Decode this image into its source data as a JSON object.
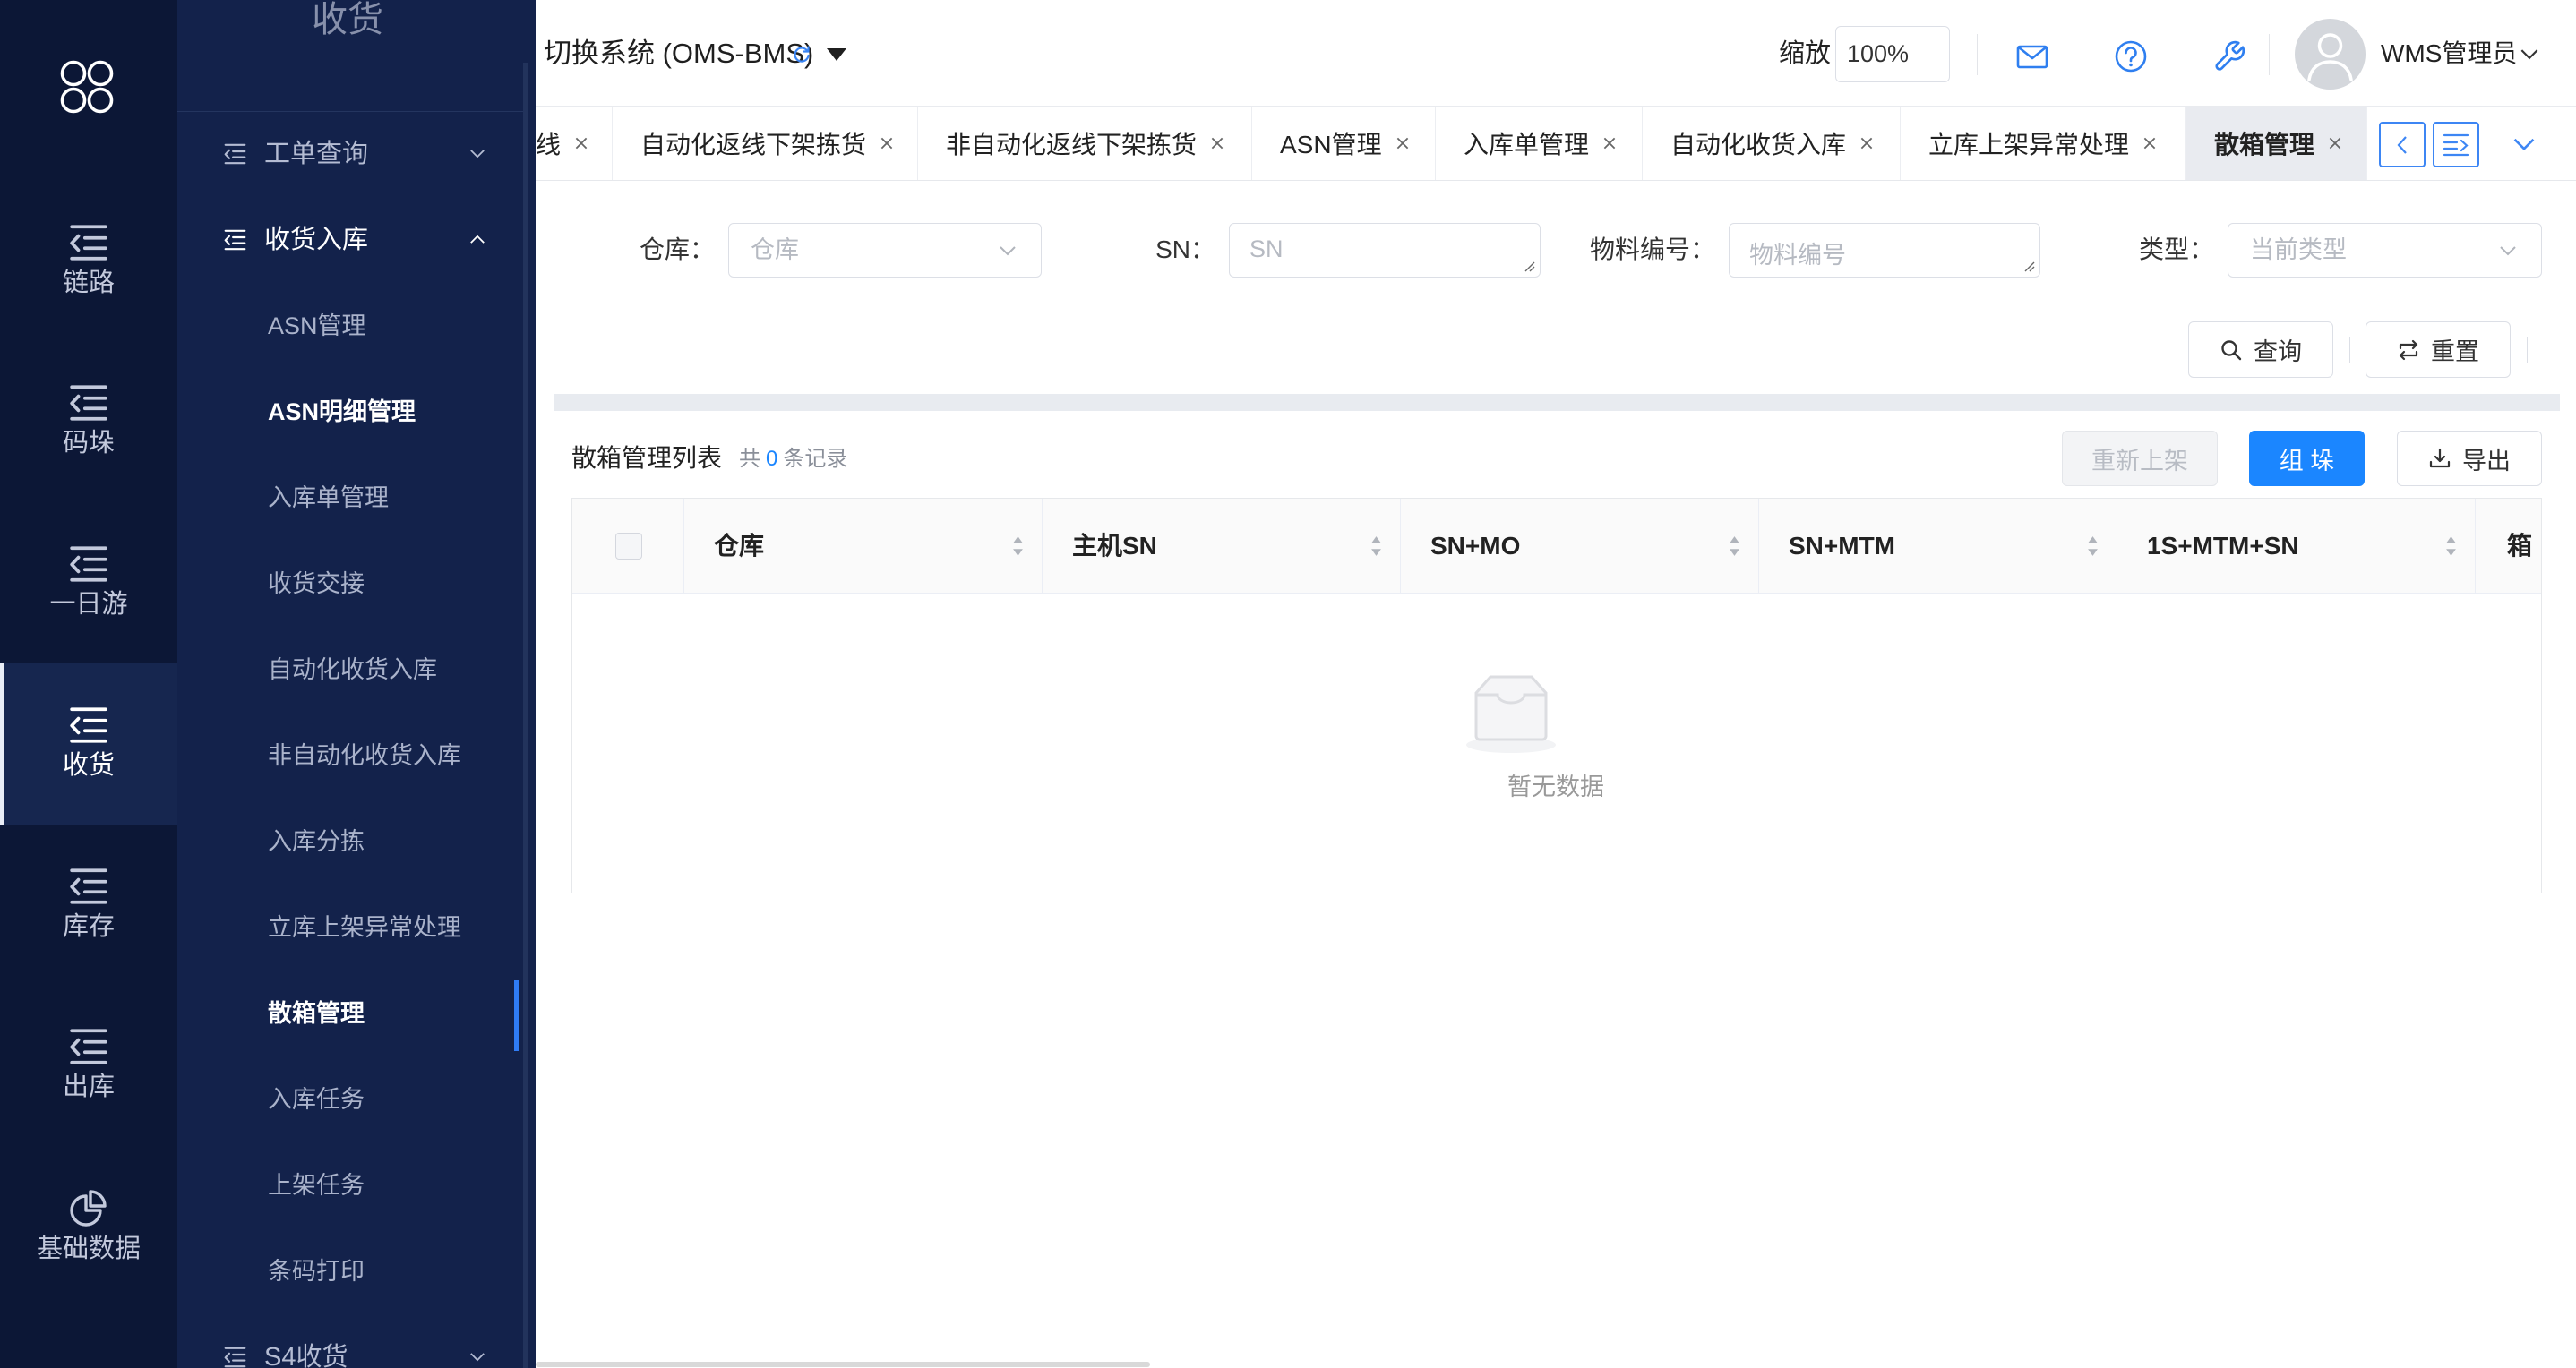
{
  "rail": {
    "logo_icon": "clover-logo-icon",
    "items": [
      {
        "label": "链路",
        "icon": "menu-fold-icon"
      },
      {
        "label": "码垛",
        "icon": "menu-fold-icon"
      },
      {
        "label": "一日游",
        "icon": "menu-fold-icon"
      },
      {
        "label": "收货",
        "icon": "menu-fold-icon",
        "active": true
      },
      {
        "label": "库存",
        "icon": "menu-fold-icon"
      },
      {
        "label": "出库",
        "icon": "menu-fold-icon"
      },
      {
        "label": "基础数据",
        "icon": "pie-chart-icon"
      }
    ]
  },
  "submenu": {
    "title": "收货",
    "groups": [
      {
        "label": "工单查询",
        "icon": "menu-fold-icon",
        "expanded": false
      },
      {
        "label": "收货入库",
        "icon": "menu-fold-icon",
        "expanded": true,
        "items": [
          "ASN管理",
          "ASN明细管理",
          "入库单管理",
          "收货交接",
          "自动化收货入库",
          "非自动化收货入库",
          "入库分拣",
          "立库上架异常处理",
          "散箱管理",
          "入库任务",
          "上架任务",
          "条码打印"
        ]
      },
      {
        "label": "S4收货",
        "icon": "menu-fold-icon",
        "expanded": false
      }
    ],
    "active_item": "散箱管理",
    "highlighted_item": "ASN明细管理"
  },
  "header": {
    "system_switch": "切换系统 (OMS-BMS)",
    "zoom_label": "缩放",
    "zoom_value": "100%",
    "icons": [
      "mail-icon",
      "help-icon",
      "wrench-icon"
    ],
    "user_name": "WMS管理员"
  },
  "tabs": {
    "items": [
      "线",
      "自动化返线下架拣货",
      "非自动化返线下架拣货",
      "ASN管理",
      "入库单管理",
      "自动化收货入库",
      "立库上架异常处理",
      "散箱管理"
    ],
    "active": "散箱管理"
  },
  "filters": {
    "warehouse": {
      "label": "仓库：",
      "placeholder": "仓库"
    },
    "sn": {
      "label": "SN：",
      "placeholder": "SN"
    },
    "material": {
      "label": "物料编号：",
      "placeholder": "物料编号"
    },
    "type": {
      "label": "类型：",
      "placeholder": "当前类型"
    },
    "search_button": "查询",
    "reset_button": "重置"
  },
  "list": {
    "title": "散箱管理列表",
    "count_prefix": "共",
    "count": "0",
    "count_suffix": "条记录",
    "buttons": {
      "reshelve": "重新上架",
      "palletize": "组 垛",
      "export": "导出"
    }
  },
  "table": {
    "columns": [
      "仓库",
      "主机SN",
      "SN+MO",
      "SN+MTM",
      "1S+MTM+SN",
      "箱"
    ],
    "rows": [],
    "empty_text": "暂无数据"
  },
  "colors": {
    "rail_bg": "#0c1736",
    "submenu_bg": "#13224b",
    "accent": "#1b86ff",
    "active_tab_bg": "#e9ebf0"
  }
}
